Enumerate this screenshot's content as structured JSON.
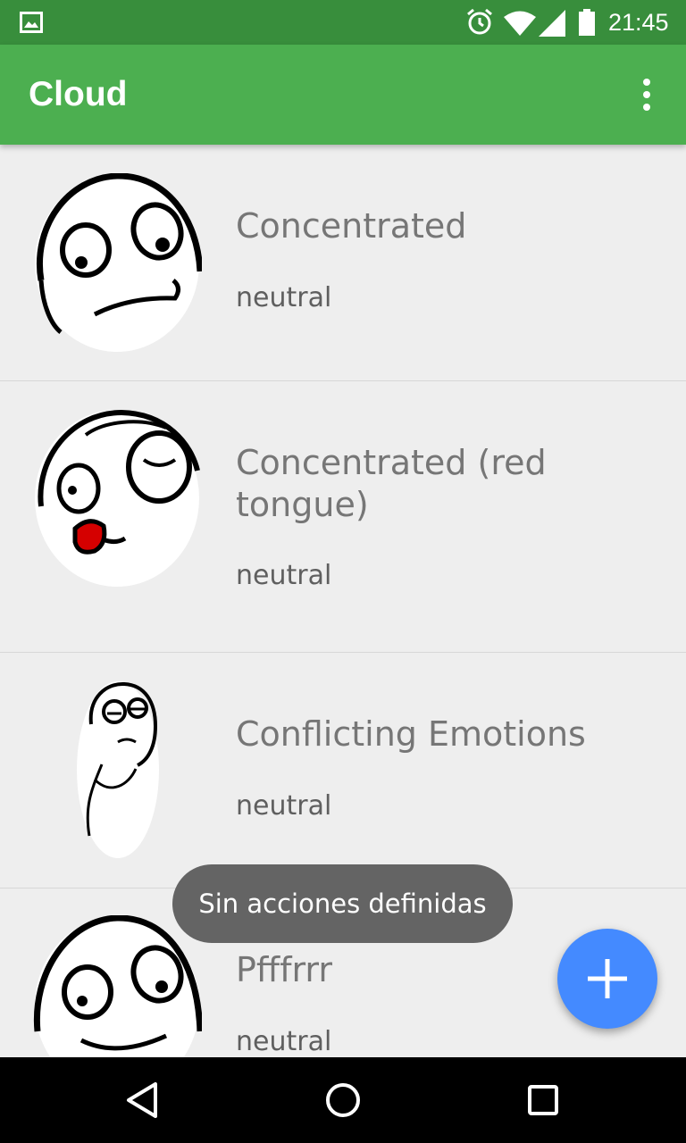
{
  "status_bar": {
    "time": "21:45",
    "icons": [
      "gallery-icon",
      "alarm-icon",
      "wifi-icon",
      "signal-icon",
      "battery-icon"
    ]
  },
  "app_bar": {
    "title": "Cloud",
    "overflow_icon": "more-vert-icon"
  },
  "items": [
    {
      "name": "Concentrated",
      "mood": "neutral"
    },
    {
      "name": "Concentrated (red tongue)",
      "mood": "neutral"
    },
    {
      "name": "Conflicting Emotions",
      "mood": "neutral"
    },
    {
      "name": "Pfffrrr",
      "mood": "neutral"
    }
  ],
  "toast": {
    "text": "Sin acciones definidas"
  },
  "fab": {
    "icon": "plus-icon",
    "color": "#448aff"
  },
  "nav_bar": {
    "icons": [
      "back-icon",
      "home-icon",
      "recents-icon"
    ]
  },
  "colors": {
    "status_bar": "#388e3c",
    "app_bar": "#4caf50",
    "background": "#eeeeee"
  }
}
